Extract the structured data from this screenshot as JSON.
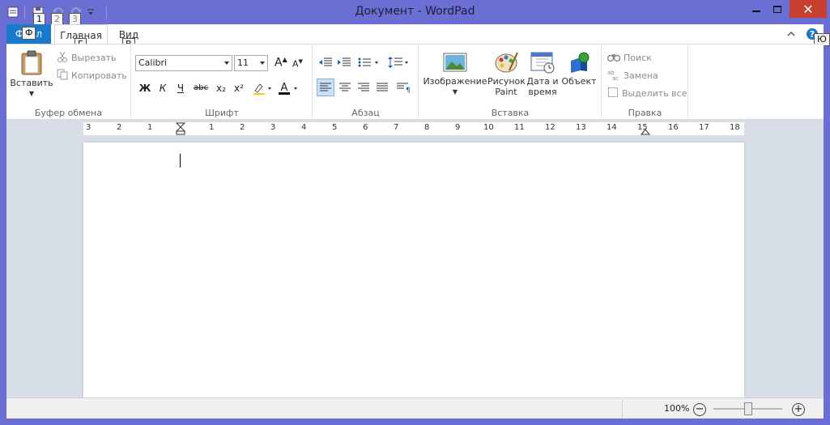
{
  "window": {
    "title": "Документ - WordPad"
  },
  "quick_access": {
    "keytips": [
      "1",
      "2",
      "3"
    ]
  },
  "tabs": {
    "file": {
      "label": "Файл",
      "keytip": "Ф"
    },
    "home": {
      "label": "Главная",
      "keytip": "Г"
    },
    "view": {
      "label": "Вид",
      "keytip": "В"
    },
    "help_keytip": "Ю"
  },
  "clipboard": {
    "paste": "Вставить",
    "cut": "Вырезать",
    "copy": "Копировать",
    "label": "Буфер обмена"
  },
  "font": {
    "family": "Calibri",
    "size": "11",
    "bold": "Ж",
    "italic": "К",
    "underline": "Ч",
    "strike": "abc",
    "subscript": "x₂",
    "superscript": "x²",
    "label": "Шрифт"
  },
  "paragraph": {
    "label": "Абзац"
  },
  "insert": {
    "picture": "Изображение",
    "paint_line1": "Рисунок",
    "paint_line2": "Paint",
    "datetime_line1": "Дата и",
    "datetime_line2": "время",
    "object": "Объект",
    "label": "Вставка"
  },
  "editing": {
    "find": "Поиск",
    "replace": "Замена",
    "select_all": "Выделить все",
    "label": "Правка"
  },
  "ruler": {
    "marks": [
      "3",
      "2",
      "1",
      "1",
      "2",
      "3",
      "4",
      "5",
      "6",
      "7",
      "8",
      "9",
      "10",
      "11",
      "12",
      "13",
      "14",
      "15",
      "16",
      "17",
      "18"
    ]
  },
  "status": {
    "zoom": "100%"
  },
  "colors": {
    "frame": "#6b6fd4",
    "file_tab": "#1979ca",
    "close": "#c7402f"
  }
}
